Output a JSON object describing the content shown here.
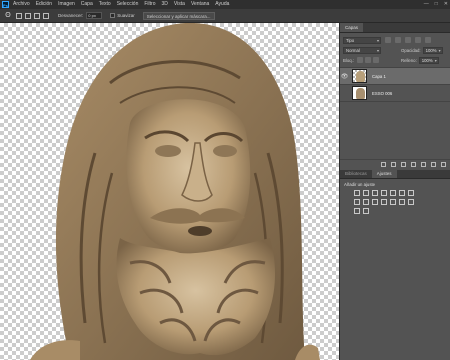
{
  "menubar": {
    "logo": "Ps",
    "items": [
      "Archivo",
      "Edición",
      "Imagen",
      "Capa",
      "Texto",
      "Selección",
      "Filtro",
      "3D",
      "Vista",
      "Ventana",
      "Ayuda"
    ],
    "window_controls": [
      "—",
      "□",
      "✕"
    ]
  },
  "options": {
    "desenfocar_label": "Desvanecer:",
    "desenfocar_value": "0 px",
    "suavizar_label": "Suavizar",
    "select_mask_button": "Seleccionar y aplicar máscara..."
  },
  "panel": {
    "tab_layers": "Capas",
    "search_kind": "Tipo",
    "blend_mode": "Normal",
    "opacity_label": "Opacidad:",
    "opacity_value": "100%",
    "lock_label": "Bloq.:",
    "fill_label": "Relleno:",
    "fill_value": "100%",
    "layers": [
      {
        "name": "Capa 1",
        "selected": true
      },
      {
        "name": "ESSO 006",
        "selected": false
      }
    ],
    "tab_libraries": "Bibliotecas",
    "tab_adjustments": "Ajustes",
    "adjust_heading": "Añadir un ajuste"
  },
  "colors": {
    "ui_dark": "#2f2f2f",
    "panel": "#535353",
    "accent": "#31a8ff"
  }
}
